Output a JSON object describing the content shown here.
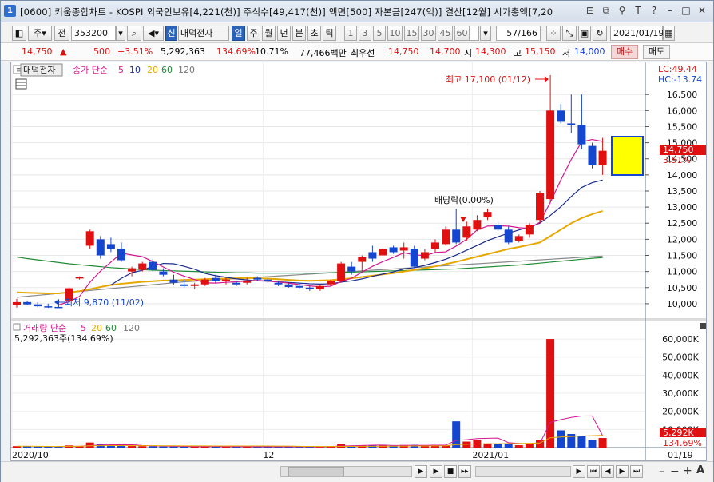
{
  "title": {
    "badge": "1",
    "text": "[0600] 키움종합차트 - KOSPI 외국인보유[4,221(천)] 주식수[49,417(천)] 액면[500] 자본금[247(억)] 결산[12월] 시가총액[7,20"
  },
  "toolbar": {
    "type_label": "주",
    "prev_label": "전",
    "code": "353200",
    "name_prefix": "신",
    "name": "대덕전자",
    "periods": [
      "일",
      "주",
      "월",
      "년",
      "분",
      "초",
      "틱"
    ],
    "selected_period": "일",
    "intervals": [
      "1",
      "3",
      "5",
      "10",
      "15",
      "30",
      "45",
      "60"
    ],
    "interval_value": "3",
    "page_count": "57/166",
    "date": "2021/01/19"
  },
  "quote": {
    "price": "14,750",
    "change": "500",
    "change_rate": "+3.51%",
    "volume": "5,292,363",
    "volume_rate": "134.69%",
    "turnover": "10.71%",
    "amount": "77,466백만",
    "best_bid_label": "최우선",
    "ask": "14,750",
    "bid": "14,700",
    "open_label": "시",
    "open": "14,300",
    "high_label": "고",
    "high": "15,150",
    "low_label": "저",
    "low": "14,000",
    "buy_label": "매수",
    "sell_label": "매도"
  },
  "legend_price": {
    "name": "대덕전자",
    "ma_title": "종가 단순",
    "ma_periods": [
      "5",
      "10",
      "20",
      "60",
      "120"
    ]
  },
  "legend_volume": {
    "title": "거래량 단순",
    "ma_periods": [
      "5",
      "20",
      "60",
      "120"
    ],
    "value": "5,292,363주(134.69%)"
  },
  "annotations": {
    "high": "최고 17,100 (01/12)",
    "low": "최저 9,870 (11/02)",
    "dividend": "배당락(0.00%)"
  },
  "right_info": {
    "lc": "LC:49.44",
    "hc": "HC:-13.74",
    "price_label": "14,750",
    "rate_label": "3.51%",
    "volume_label": "5,292K",
    "volume_rate_label": "134.69%"
  },
  "x_labels": [
    "2020/10",
    "12",
    "2021/01",
    "01/19"
  ],
  "colors": {
    "up": "#e01010",
    "down": "#1546d0",
    "ma5": "#d4178f",
    "ma10": "#1a2a8a",
    "ma20": "#e6a800",
    "ma60": "#1f8a35",
    "ma120": "#8a8a8a"
  },
  "chart_data": {
    "type": "candlestick",
    "y_ticks": [
      10000,
      10500,
      11000,
      11500,
      12000,
      12500,
      13000,
      13500,
      14000,
      14500,
      15000,
      15500,
      16000,
      16500
    ],
    "ylim": [
      9600,
      17300
    ],
    "volume_ticks": [
      10000,
      20000,
      30000,
      40000,
      50000,
      60000
    ],
    "volume_tick_labels": [
      "10,000K",
      "20,000K",
      "30,000K",
      "40,000K",
      "50,000K",
      "60,000K"
    ],
    "volume_ylim": [
      0,
      64000
    ],
    "candles": [
      {
        "o": 9950,
        "h": 10150,
        "l": 9880,
        "c": 10050,
        "v": 800
      },
      {
        "o": 10050,
        "h": 10100,
        "l": 9950,
        "c": 9980,
        "v": 700
      },
      {
        "o": 9980,
        "h": 10050,
        "l": 9890,
        "c": 9920,
        "v": 600
      },
      {
        "o": 9920,
        "h": 10000,
        "l": 9870,
        "c": 9900,
        "v": 500
      },
      {
        "o": 9900,
        "h": 9950,
        "l": 9870,
        "c": 9880,
        "v": 500
      },
      {
        "o": 10100,
        "h": 10500,
        "l": 10050,
        "c": 10480,
        "v": 1200
      },
      {
        "o": 10800,
        "h": 10850,
        "l": 10750,
        "c": 10820,
        "v": 700
      },
      {
        "o": 11800,
        "h": 12300,
        "l": 11700,
        "c": 12250,
        "v": 2800
      },
      {
        "o": 12000,
        "h": 12100,
        "l": 11400,
        "c": 11500,
        "v": 1800
      },
      {
        "o": 11850,
        "h": 12050,
        "l": 11600,
        "c": 11700,
        "v": 1300
      },
      {
        "o": 11700,
        "h": 11900,
        "l": 11300,
        "c": 11350,
        "v": 1100
      },
      {
        "o": 11000,
        "h": 11150,
        "l": 10850,
        "c": 11100,
        "v": 900
      },
      {
        "o": 11050,
        "h": 11300,
        "l": 11000,
        "c": 11250,
        "v": 800
      },
      {
        "o": 11300,
        "h": 11400,
        "l": 11000,
        "c": 11050,
        "v": 700
      },
      {
        "o": 11000,
        "h": 11100,
        "l": 10850,
        "c": 10900,
        "v": 600
      },
      {
        "o": 10750,
        "h": 10900,
        "l": 10600,
        "c": 10650,
        "v": 600
      },
      {
        "o": 10600,
        "h": 10750,
        "l": 10500,
        "c": 10550,
        "v": 500
      },
      {
        "o": 10550,
        "h": 10650,
        "l": 10450,
        "c": 10600,
        "v": 500
      },
      {
        "o": 10600,
        "h": 10800,
        "l": 10550,
        "c": 10750,
        "v": 700
      },
      {
        "o": 10800,
        "h": 10900,
        "l": 10650,
        "c": 10700,
        "v": 600
      },
      {
        "o": 10700,
        "h": 10800,
        "l": 10600,
        "c": 10750,
        "v": 500
      },
      {
        "o": 10650,
        "h": 10700,
        "l": 10550,
        "c": 10600,
        "v": 500
      },
      {
        "o": 10650,
        "h": 10800,
        "l": 10600,
        "c": 10720,
        "v": 500
      },
      {
        "o": 10800,
        "h": 10850,
        "l": 10700,
        "c": 10750,
        "v": 500
      },
      {
        "o": 10750,
        "h": 10800,
        "l": 10650,
        "c": 10700,
        "v": 500
      },
      {
        "o": 10650,
        "h": 10700,
        "l": 10550,
        "c": 10600,
        "v": 500
      },
      {
        "o": 10600,
        "h": 10650,
        "l": 10500,
        "c": 10520,
        "v": 500
      },
      {
        "o": 10550,
        "h": 10650,
        "l": 10450,
        "c": 10500,
        "v": 500
      },
      {
        "o": 10500,
        "h": 10550,
        "l": 10400,
        "c": 10450,
        "v": 500
      },
      {
        "o": 10450,
        "h": 10600,
        "l": 10400,
        "c": 10550,
        "v": 600
      },
      {
        "o": 10600,
        "h": 10750,
        "l": 10550,
        "c": 10700,
        "v": 800
      },
      {
        "o": 10700,
        "h": 11300,
        "l": 10650,
        "c": 11250,
        "v": 2000
      },
      {
        "o": 11150,
        "h": 11300,
        "l": 10900,
        "c": 11000,
        "v": 1100
      },
      {
        "o": 11300,
        "h": 11500,
        "l": 11000,
        "c": 11450,
        "v": 1300
      },
      {
        "o": 11600,
        "h": 11800,
        "l": 11300,
        "c": 11400,
        "v": 1300
      },
      {
        "o": 11500,
        "h": 11800,
        "l": 11400,
        "c": 11700,
        "v": 1100
      },
      {
        "o": 11750,
        "h": 11800,
        "l": 11550,
        "c": 11600,
        "v": 1000
      },
      {
        "o": 11650,
        "h": 11900,
        "l": 11400,
        "c": 11750,
        "v": 1400
      },
      {
        "o": 11700,
        "h": 11800,
        "l": 11100,
        "c": 11150,
        "v": 1500
      },
      {
        "o": 11400,
        "h": 11700,
        "l": 11350,
        "c": 11600,
        "v": 1100
      },
      {
        "o": 11700,
        "h": 12000,
        "l": 11600,
        "c": 11900,
        "v": 1500
      },
      {
        "o": 11850,
        "h": 12400,
        "l": 11800,
        "c": 12300,
        "v": 1400
      },
      {
        "o": 12300,
        "h": 12950,
        "l": 11850,
        "c": 11900,
        "v": 14500
      },
      {
        "o": 12050,
        "h": 12550,
        "l": 11950,
        "c": 12400,
        "v": 3300
      },
      {
        "o": 12300,
        "h": 12750,
        "l": 12250,
        "c": 12600,
        "v": 4200
      },
      {
        "o": 12700,
        "h": 12950,
        "l": 12600,
        "c": 12850,
        "v": 2300
      },
      {
        "o": 12450,
        "h": 12550,
        "l": 12250,
        "c": 12300,
        "v": 1800
      },
      {
        "o": 12300,
        "h": 12400,
        "l": 11850,
        "c": 11900,
        "v": 1900
      },
      {
        "o": 11950,
        "h": 12150,
        "l": 11900,
        "c": 12100,
        "v": 1300
      },
      {
        "o": 12150,
        "h": 12500,
        "l": 12050,
        "c": 12450,
        "v": 2300
      },
      {
        "o": 12600,
        "h": 13500,
        "l": 12500,
        "c": 13450,
        "v": 4100
      },
      {
        "o": 13250,
        "h": 17100,
        "l": 13150,
        "c": 16000,
        "v": 60000
      },
      {
        "o": 16000,
        "h": 16200,
        "l": 15600,
        "c": 15650,
        "v": 9500
      },
      {
        "o": 15600,
        "h": 16500,
        "l": 15300,
        "c": 15550,
        "v": 7500
      },
      {
        "o": 15550,
        "h": 16500,
        "l": 14800,
        "c": 14950,
        "v": 6200
      },
      {
        "o": 14900,
        "h": 15000,
        "l": 14200,
        "c": 14300,
        "v": 4300
      },
      {
        "o": 14300,
        "h": 15150,
        "l": 14000,
        "c": 14750,
        "v": 5292
      }
    ],
    "ma5": [
      null,
      null,
      null,
      null,
      9960,
      10062,
      10226,
      10672,
      11012,
      11294,
      11572,
      11512,
      11460,
      11310,
      11140,
      10976,
      10856,
      10750,
      10650,
      10640,
      10664,
      10680,
      10706,
      10724,
      10704,
      10674,
      10638,
      10594,
      10554,
      10524,
      10544,
      10690,
      10790,
      10980,
      11160,
      11310,
      11440,
      11580,
      11520,
      11490,
      11590,
      11610,
      11790,
      12000,
      12290,
      12410,
      12420,
      12410,
      12360,
      12340,
      12530,
      13150,
      13840,
      14480,
      15030,
      15100,
      15040
    ],
    "ma10": [
      null,
      null,
      null,
      null,
      null,
      null,
      null,
      null,
      null,
      10580,
      10790,
      10960,
      11040,
      11160,
      11250,
      11240,
      11160,
      11070,
      10940,
      10870,
      10820,
      10770,
      10740,
      10710,
      10700,
      10680,
      10660,
      10640,
      10620,
      10610,
      10620,
      10670,
      10710,
      10770,
      10850,
      10920,
      10990,
      11080,
      11120,
      11190,
      11280,
      11380,
      11510,
      11660,
      11810,
      11960,
      12080,
      12190,
      12290,
      12380,
      12500,
      12740,
      13010,
      13330,
      13610,
      13760,
      13840
    ],
    "ma20": [
      10350,
      10340,
      10330,
      10320,
      10320,
      10350,
      10390,
      10450,
      10520,
      10580,
      10620,
      10650,
      10680,
      10700,
      10720,
      10720,
      10740,
      10750,
      10760,
      10770,
      10780,
      10790,
      10800,
      10790,
      10780,
      10760,
      10740,
      10720,
      10710,
      10720,
      10730,
      10760,
      10790,
      10830,
      10870,
      10910,
      10950,
      11000,
      11050,
      11100,
      11160,
      11230,
      11300,
      11380,
      11460,
      11540,
      11620,
      11700,
      11760,
      11830,
      11900,
      12100,
      12300,
      12500,
      12660,
      12780,
      12880
    ],
    "ma60": [
      11450,
      11400,
      11360,
      11320,
      11280,
      11240,
      11210,
      11180,
      11150,
      11120,
      11100,
      11080,
      11060,
      11040,
      11030,
      11020,
      11010,
      11000,
      10990,
      10980,
      10970,
      10960,
      10960,
      10950,
      10950,
      10950,
      10950,
      10950,
      10950,
      10950,
      10960,
      10970,
      10980,
      10990,
      11000,
      11010,
      11020,
      11030,
      11040,
      11050,
      11060,
      11070,
      11080,
      11100,
      11120,
      11140,
      11160,
      11180,
      11200,
      11230,
      11260,
      11290,
      11320,
      11350,
      11380,
      11410,
      11430
    ],
    "ma120": [
      10200,
      10230,
      10260,
      10290,
      10320,
      10350,
      10380,
      10410,
      10440,
      10470,
      10500,
      10530,
      10560,
      10590,
      10620,
      10650,
      10680,
      10700,
      10720,
      10740,
      10760,
      10780,
      10800,
      10820,
      10840,
      10860,
      10880,
      10900,
      10920,
      10940,
      10960,
      10980,
      11000,
      11020,
      11040,
      11060,
      11080,
      11100,
      11120,
      11140,
      11160,
      11180,
      11200,
      11220,
      11240,
      11260,
      11280,
      11300,
      11320,
      11340,
      11360,
      11380,
      11400,
      11420,
      11440,
      11460,
      11480
    ]
  }
}
